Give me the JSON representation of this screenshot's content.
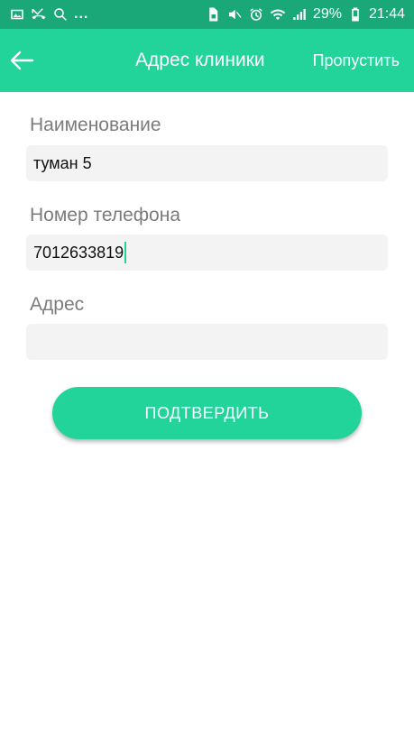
{
  "status_bar": {
    "left_icons": [
      "image-icon",
      "missed-call-icon",
      "search-icon"
    ],
    "overflow_indicator": "...",
    "right_icons": [
      "sim-icon",
      "mute-icon",
      "alarm-icon",
      "wifi-icon",
      "signal-icon"
    ],
    "battery": "29%",
    "time": "21:44"
  },
  "app_bar": {
    "back_icon": "arrow-left-icon",
    "title": "Адрес клиники",
    "skip_label": "Пропустить"
  },
  "form": {
    "name": {
      "label": "Наименование",
      "value": "туман 5"
    },
    "phone": {
      "label": "Номер телефона",
      "value": "7012633819"
    },
    "address": {
      "label": "Адрес",
      "value": ""
    }
  },
  "confirm_button": {
    "label": "ПОДТВЕРДИТЬ"
  },
  "colors": {
    "accent": "#22d39a",
    "status_bar": "#1aa879",
    "input_bg": "#f3f3f3",
    "label": "#7b7b7b"
  }
}
